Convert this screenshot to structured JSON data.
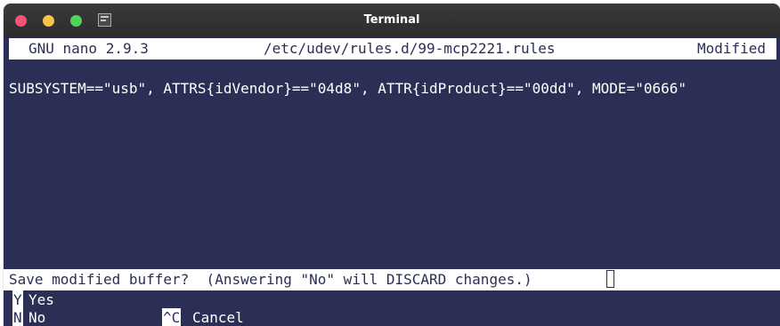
{
  "window": {
    "title": "Terminal",
    "colors": {
      "background": "#2b2f55",
      "titlebar": "#2c2c2c",
      "close": "#f1537a",
      "minimize": "#f6c44a",
      "maximize": "#4fd45a"
    },
    "icon": "terminal-icon"
  },
  "nano": {
    "version": "GNU nano 2.9.3",
    "filename": "/etc/udev/rules.d/99-mcp2221.rules",
    "status": "Modified",
    "content_line": "SUBSYSTEM==\"usb\", ATTRS{idVendor}==\"04d8\", ATTR{idProduct}==\"00dd\", MODE=\"0666\"",
    "prompt": "Save modified buffer?  (Answering \"No\" will DISCARD changes.)",
    "options": {
      "yes_key": "Y",
      "yes_label": "Yes",
      "no_key": "N",
      "no_label": "No",
      "cancel_key": "^C",
      "cancel_label": "Cancel"
    }
  }
}
